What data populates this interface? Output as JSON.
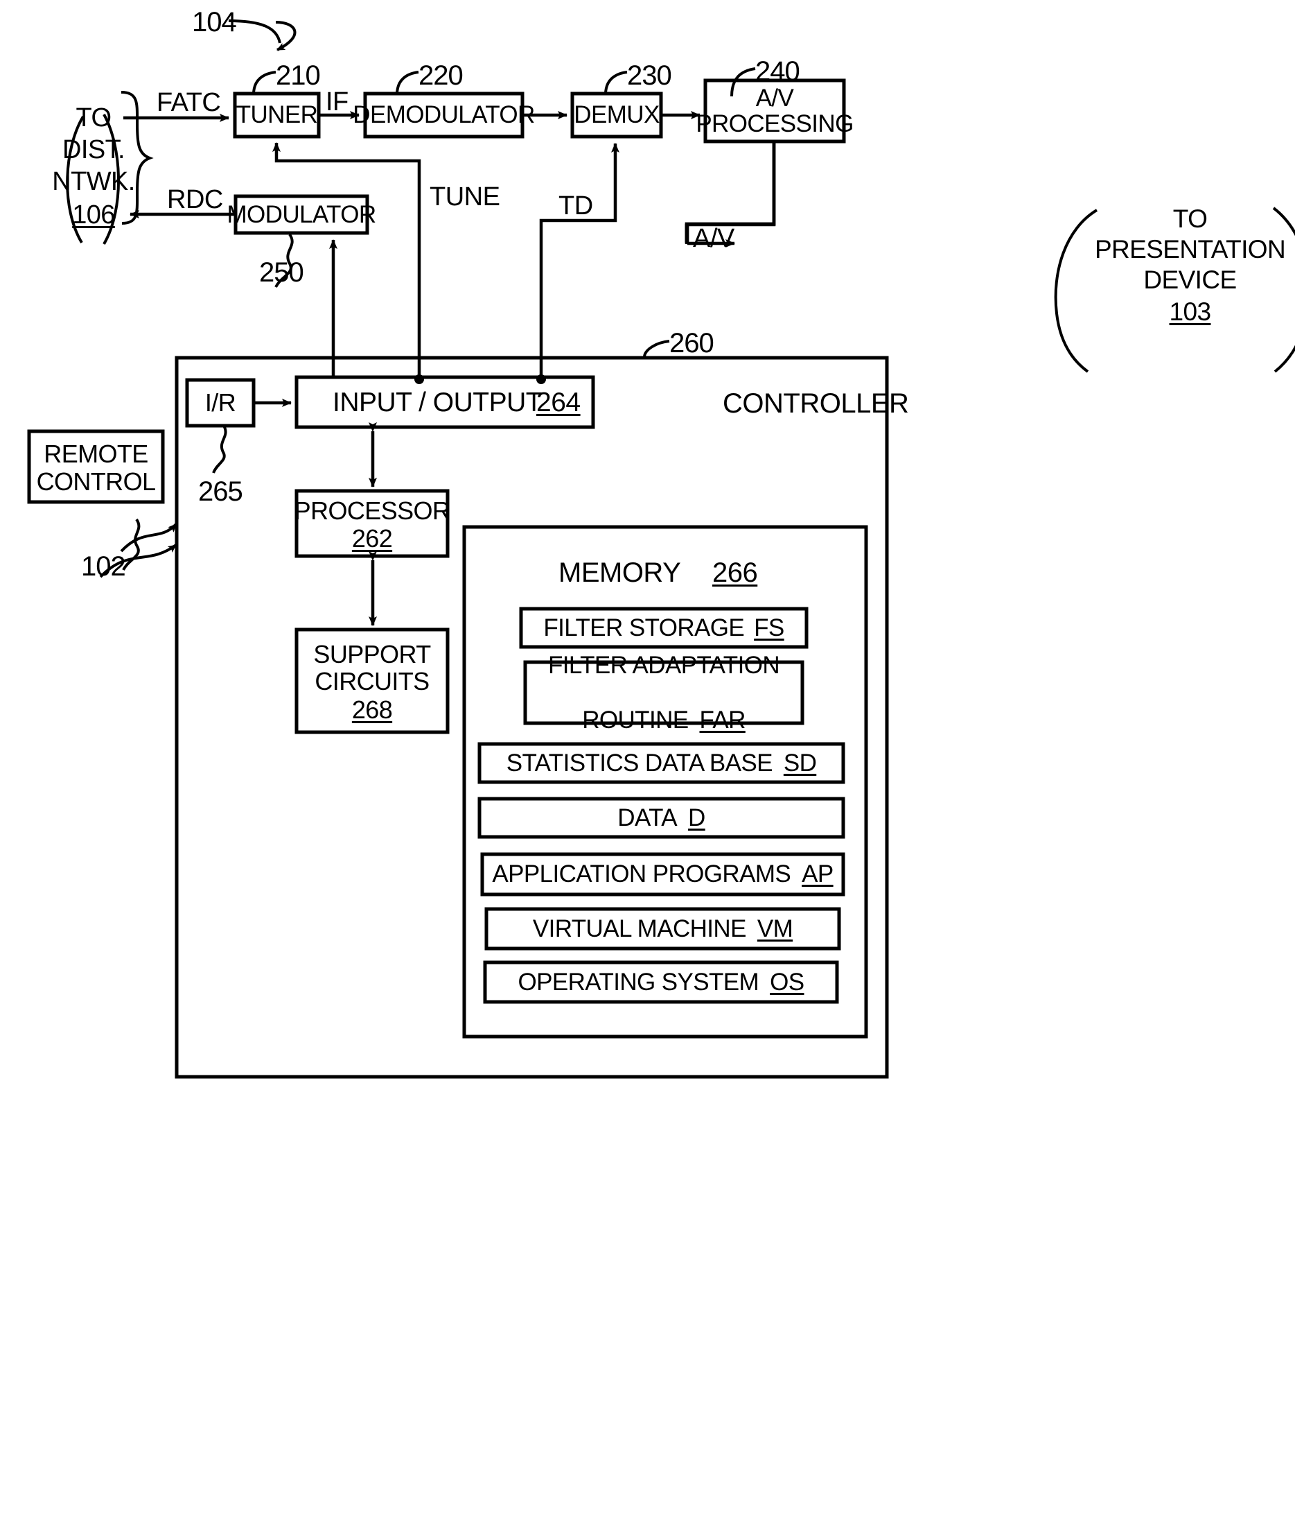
{
  "figure": {
    "top_reference": "104",
    "controller_reference": "260",
    "controller_label": "CONTROLLER"
  },
  "blocks": {
    "dist_network": {
      "line1": "TO",
      "line2": "DIST.",
      "line3": "NTWK.",
      "ref": "106"
    },
    "tuner": {
      "label": "TUNER",
      "ref": "210"
    },
    "demodulator": {
      "label": "DEMODULATOR",
      "ref": "220"
    },
    "demux": {
      "label": "DEMUX",
      "ref": "230"
    },
    "av_processing": {
      "line1": "A/V",
      "line2": "PROCESSING",
      "ref": "240"
    },
    "modulator": {
      "label": "MODULATOR",
      "ref": "250"
    },
    "presentation_device": {
      "line1": "TO",
      "line2": "PRESENTATION",
      "line3": "DEVICE",
      "ref": "103"
    },
    "remote_control": {
      "line1": "REMOTE",
      "line2": "CONTROL",
      "ref": "102"
    },
    "ir": {
      "label": "I/R",
      "ref": "265"
    },
    "input_output": {
      "label": "INPUT / OUTPUT",
      "ref": "264"
    },
    "processor": {
      "label": "PROCESSOR",
      "ref": "262"
    },
    "support_circuits": {
      "line1": "SUPPORT",
      "line2": "CIRCUITS",
      "ref": "268"
    },
    "memory": {
      "label": "MEMORY",
      "ref": "266"
    }
  },
  "memory_items": [
    {
      "label": "FILTER STORAGE",
      "abbr": "FS"
    },
    {
      "label": "FILTER ADAPTATION\nROUTINE",
      "abbr": "FAR"
    },
    {
      "label": "STATISTICS DATA BASE",
      "abbr": "SD"
    },
    {
      "label": "DATA",
      "abbr": "D"
    },
    {
      "label": "APPLICATION PROGRAMS",
      "abbr": "AP"
    },
    {
      "label": "VIRTUAL MACHINE",
      "abbr": "VM"
    },
    {
      "label": "OPERATING SYSTEM",
      "abbr": "OS"
    }
  ],
  "signals": {
    "fatc": "FATC",
    "if": "IF",
    "rdc": "RDC",
    "tune": "TUNE",
    "td": "TD",
    "av": "A/V"
  },
  "colors": {
    "ink": "#000000",
    "paper": "#ffffff"
  }
}
